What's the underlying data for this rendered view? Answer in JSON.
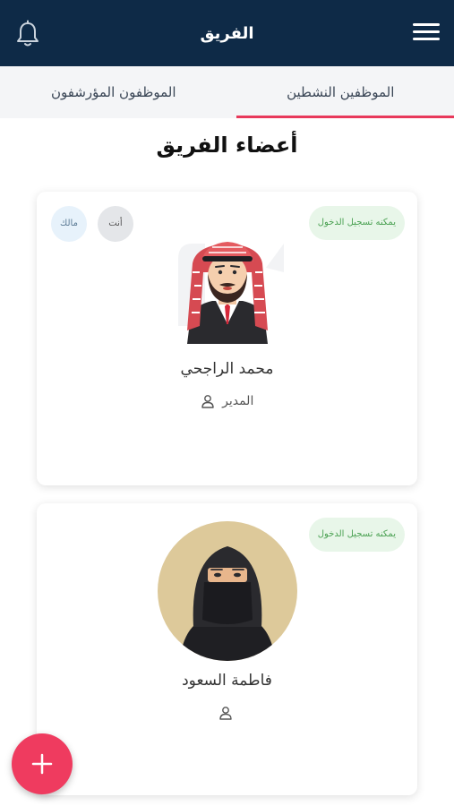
{
  "header": {
    "title": "الفريق",
    "bell_icon": "bell-icon",
    "menu_icon": "hamburger-menu-icon"
  },
  "tabs": [
    {
      "label": "الموظفين النشطين",
      "active": true
    },
    {
      "label": "الموظفون المؤرشفون",
      "active": false
    }
  ],
  "section_title": "أعضاء الفريق",
  "members": [
    {
      "name": "محمد الراجحي",
      "role": "المدير",
      "login_badge": "يمكنه تسجيل الدخول",
      "you_badge": "أنت",
      "owner_badge": "مالك"
    },
    {
      "name": "فاطمة السعود",
      "role": "",
      "login_badge": "يمكنه تسجيل الدخول"
    }
  ],
  "fab": {
    "icon": "plus-icon"
  },
  "colors": {
    "header_bg": "#0e2a47",
    "accent": "#e8395b",
    "fab": "#ef3b5f",
    "login_badge_bg": "#e8f6e9",
    "login_badge_text": "#4aa152"
  }
}
